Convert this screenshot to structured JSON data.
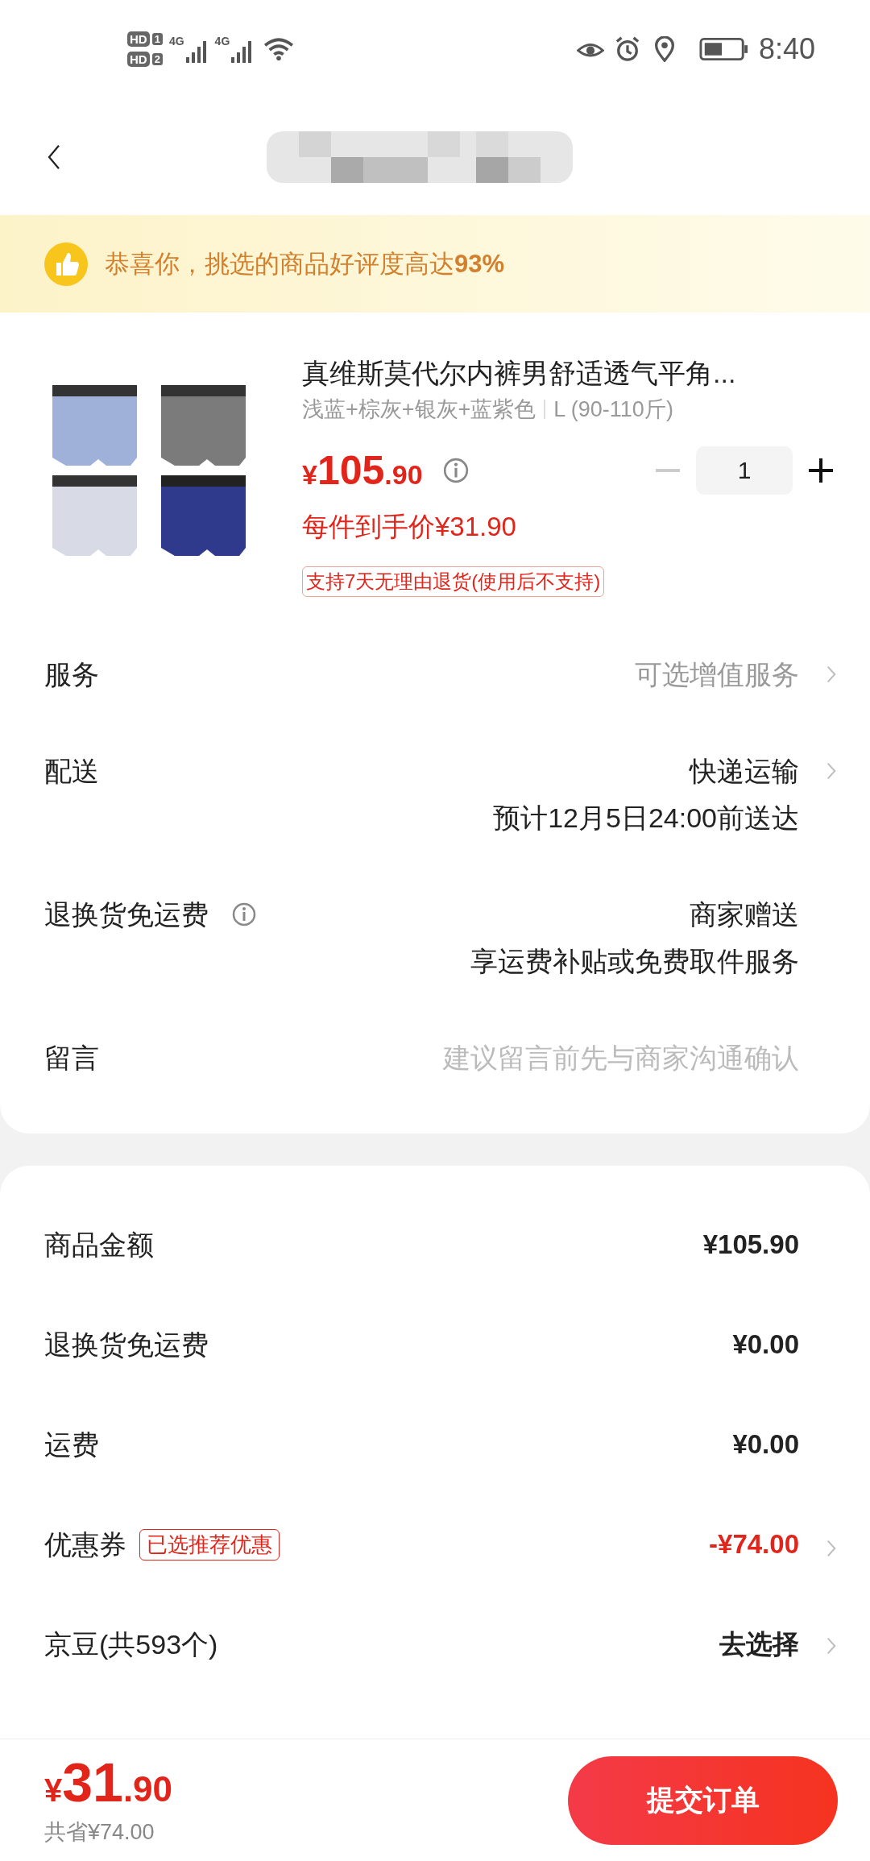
{
  "status_bar": {
    "time": "8:40",
    "sims": [
      {
        "badge": "HD",
        "slot": "1",
        "network": "4G"
      },
      {
        "badge": "HD",
        "slot": "2",
        "network": "4G"
      }
    ]
  },
  "banner": {
    "text": "恭喜你，挑选的商品好评度高达**93%**"
  },
  "product": {
    "title": "真维斯莫代尔内裤男舒适透气平角...",
    "spec": "浅蓝+棕灰+银灰+蓝紫色",
    "size": "L (90-110斤)",
    "price_symbol": "¥",
    "price_int": "105",
    "price_dec": ".90",
    "unit_price": "每件到手价¥31.90",
    "quantity": "1",
    "decrease_disabled": true,
    "return_tag": "支持7天无理由退货(使用后不支持)"
  },
  "options": [
    {
      "kind": "link",
      "label": "服务",
      "lines": [
        "可选增值服务"
      ],
      "muted": true,
      "chevron": true,
      "info": false
    },
    {
      "kind": "link",
      "label": "配送",
      "lines": [
        "快递运输",
        "预计12月5日24:00前送达"
      ],
      "muted": false,
      "chevron": true,
      "info": false
    },
    {
      "kind": "link",
      "label": "退换货免运费",
      "lines": [
        "商家赠送",
        "享运费补贴或免费取件服务"
      ],
      "muted": false,
      "chevron": false,
      "info": true
    },
    {
      "kind": "input",
      "label": "留言",
      "placeholder": "建议留言前先与商家沟通确认"
    }
  ],
  "summary": [
    {
      "label": "商品金额",
      "value": "¥105.90",
      "highlight": false,
      "chevron": false
    },
    {
      "label": "退换货免运费",
      "value": "¥0.00",
      "highlight": false,
      "chevron": false
    },
    {
      "label": "运费",
      "value": "¥0.00",
      "highlight": false,
      "chevron": false
    },
    {
      "label": "优惠券",
      "tag": "已选推荐优惠",
      "value": "-¥74.00",
      "highlight": true,
      "chevron": true
    },
    {
      "label": "京豆(共593个)",
      "value": "去选择",
      "highlight": false,
      "chevron": true
    }
  ],
  "footer": {
    "price_symbol": "¥",
    "price_int": "31",
    "price_dec": ".90",
    "saved": "共省¥74.00",
    "submit": "提交订单"
  }
}
